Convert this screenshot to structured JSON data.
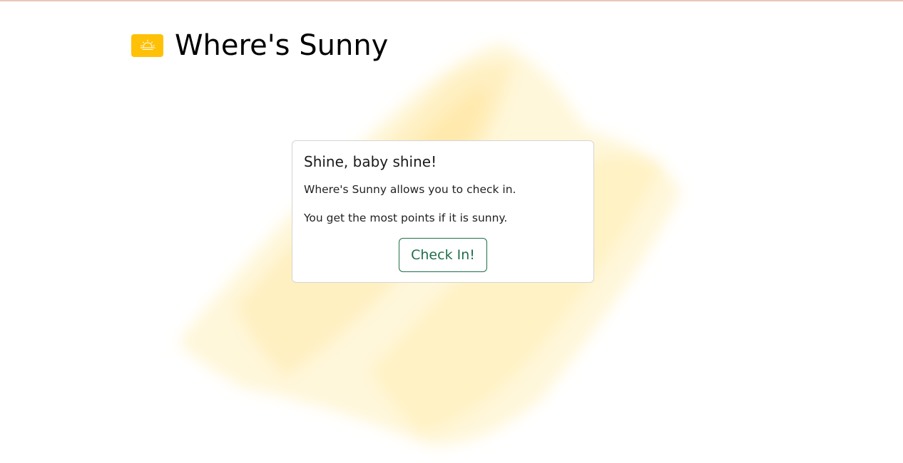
{
  "app": {
    "name": "Where's Sunny",
    "logo_icon": "sun-icon",
    "accent_color": "#ffc107"
  },
  "card": {
    "title": "Shine, baby shine!",
    "text_1": "Where's Sunny allows you to check in.",
    "text_2": "You get the most points if it is sunny.",
    "button_label": "Check In!",
    "button_color": "#1f6f4a"
  }
}
